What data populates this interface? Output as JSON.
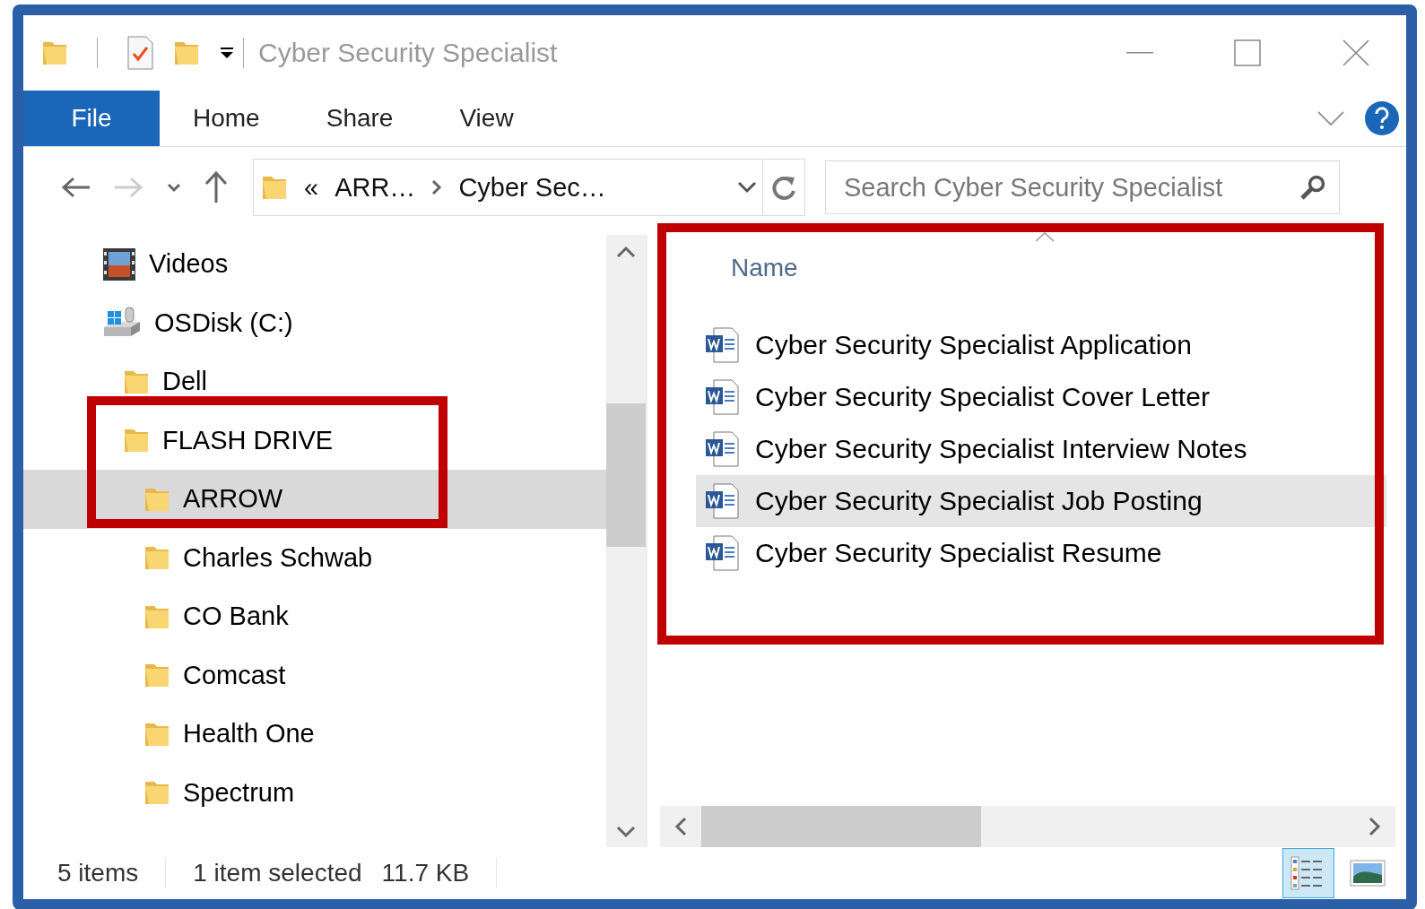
{
  "window": {
    "title": "Cyber Security Specialist"
  },
  "ribbon": {
    "tabs": [
      {
        "label": "File",
        "kind": "backstage"
      },
      {
        "label": "Home",
        "kind": "tab"
      },
      {
        "label": "Share",
        "kind": "tab"
      },
      {
        "label": "View",
        "kind": "tab"
      }
    ]
  },
  "nav_buttons": [
    {
      "kind": "back",
      "disabled": false
    },
    {
      "kind": "forward",
      "disabled": true
    },
    {
      "kind": "recent",
      "disabled": false
    },
    {
      "kind": "up",
      "disabled": false
    }
  ],
  "address": {
    "overflow": "«",
    "crumbs": [
      "ARR…",
      "Cyber Sec…"
    ]
  },
  "search": {
    "placeholder": "Search Cyber Security Specialist"
  },
  "navigation": {
    "items": [
      {
        "label": "Videos",
        "kind": "video",
        "selected": false
      },
      {
        "label": "OSDisk (C:)",
        "kind": "drive",
        "selected": false,
        "children": [
          {
            "label": "Dell",
            "kind": "folder",
            "selected": false
          },
          {
            "label": "FLASH DRIVE",
            "kind": "folder",
            "selected": false,
            "children": [
              {
                "label": "ARROW",
                "kind": "folder",
                "selected": true
              },
              {
                "label": "Charles Schwab",
                "kind": "folder",
                "selected": false
              },
              {
                "label": "CO Bank",
                "kind": "folder",
                "selected": false
              },
              {
                "label": "Comcast",
                "kind": "folder",
                "selected": false
              },
              {
                "label": "Health One",
                "kind": "folder",
                "selected": false
              },
              {
                "label": "Spectrum",
                "kind": "folder",
                "selected": false
              }
            ]
          }
        ]
      }
    ]
  },
  "files": {
    "columns": [
      "Name"
    ],
    "rows": [
      {
        "name": "Cyber Security Specialist Application",
        "selected": false
      },
      {
        "name": "Cyber Security Specialist Cover Letter",
        "selected": false
      },
      {
        "name": "Cyber Security Specialist Interview Notes",
        "selected": false
      },
      {
        "name": "Cyber Security Specialist Job Posting",
        "selected": true
      },
      {
        "name": "Cyber Security Specialist Resume",
        "selected": false
      }
    ]
  },
  "status_bar": {
    "item_count": "5 items",
    "selection": "1 item selected",
    "size": "11.7 KB"
  },
  "view_buttons": [
    {
      "kind": "details",
      "selected": true
    },
    {
      "kind": "large-icons",
      "selected": false
    }
  ],
  "highlights": [
    {
      "kind": "frame"
    },
    {
      "kind": "frame"
    }
  ]
}
